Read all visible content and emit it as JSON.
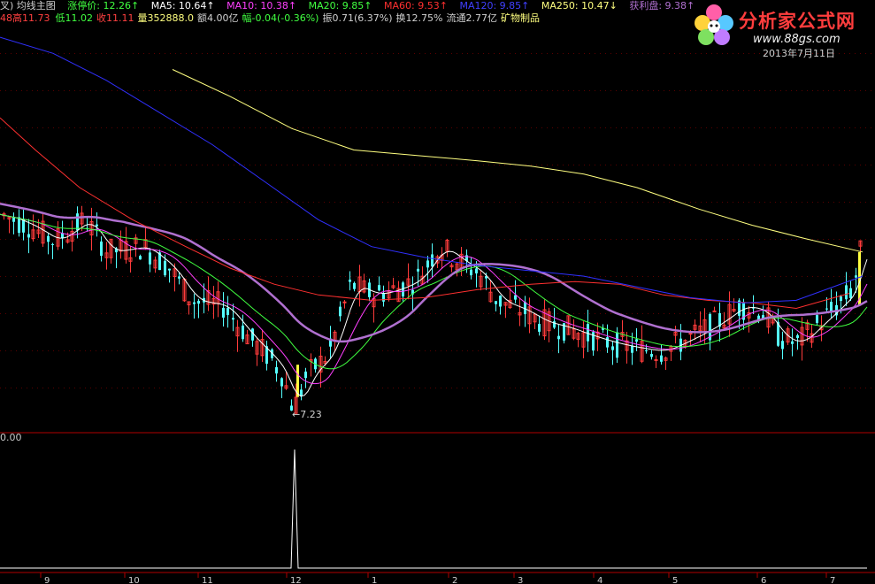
{
  "header": {
    "title": "叉) 均线主图",
    "zhangting": "涨停价: 12.26↑",
    "ma5": "MA5: 10.64↑",
    "ma10": "MA10: 10.38↑",
    "ma20": "MA20: 9.85↑",
    "ma60": "MA60: 9.53↑",
    "ma120": "MA120: 9.85↑",
    "ma250": "MA250: 10.47↓",
    "huoli": "获利盘: 9.38↑"
  },
  "stats": {
    "open": "48",
    "high": "高11.73",
    "low": "低11.02",
    "close": "收11.11",
    "volume": "量352888.0",
    "amount": "额4.00亿",
    "change": "幅-0.04(-0.36%)",
    "amplitude": "振0.71(6.37%)",
    "turnover": "换12.75%",
    "float": "流通2.77亿",
    "sector": "矿物制品"
  },
  "colors": {
    "up": "#ff3b3b",
    "down": "#54ffff",
    "ma5": "#ffffff",
    "ma10": "#ff40ff",
    "ma20": "#40ff40",
    "ma60": "#ff3030",
    "ma120": "#3030ff",
    "ma250": "#ffff80",
    "huoli": "#b070d0",
    "axis": "#b00000"
  },
  "logo": {
    "name": "分析家公式网",
    "url": "www.88gs.com",
    "icon": "flower-logo-icon"
  },
  "date_label": "2013年7月11日",
  "indicator_value": "0.00",
  "chart_data": {
    "type": "candlestick",
    "low_annotation": "←7.23",
    "x_axis_labels": [
      "9",
      "10",
      "11",
      "12",
      "1",
      "2",
      "3",
      "4",
      "5",
      "6",
      "7"
    ],
    "price_range": [
      7.0,
      14.5
    ],
    "indicator_range": [
      0,
      1
    ],
    "indicator_spike_month": "12"
  }
}
